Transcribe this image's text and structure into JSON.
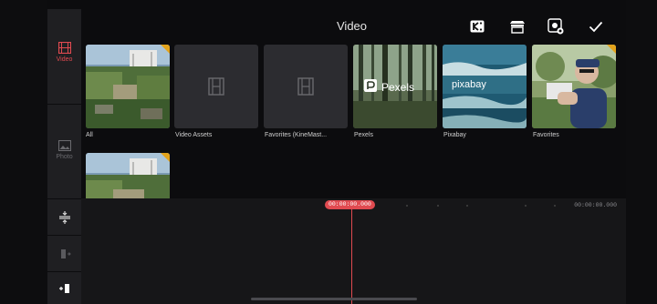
{
  "header": {
    "title": "Video"
  },
  "header_icons": [
    "kinemaster-store-icon",
    "asset-store-icon",
    "camera-capture-icon",
    "checkmark-icon"
  ],
  "sidebar": {
    "tabs": [
      {
        "label": "Video",
        "icon": "video-film-icon",
        "active": true
      },
      {
        "label": "Photo",
        "icon": "photo-icon",
        "active": false
      }
    ],
    "tools": [
      "split-vertical-icon",
      "trim-left-icon",
      "add-right-icon"
    ]
  },
  "folders": [
    {
      "caption": "All",
      "kind": "thumb"
    },
    {
      "caption": "Video Assets",
      "kind": "placeholder"
    },
    {
      "caption": "Favorites (KineMast...",
      "kind": "placeholder"
    },
    {
      "caption": "Pexels",
      "kind": "thumb",
      "overlay": "Pexels"
    },
    {
      "caption": "Pixabay",
      "kind": "thumb",
      "overlay": "pixabay"
    },
    {
      "caption": "Favorites",
      "kind": "thumb"
    }
  ],
  "timeline": {
    "current_time": "00:00:00.000",
    "end_time": "00:00:00.000"
  },
  "colors": {
    "accent": "#e04a50",
    "panel": "#1f1f22",
    "tile_placeholder": "#2c2c30"
  }
}
